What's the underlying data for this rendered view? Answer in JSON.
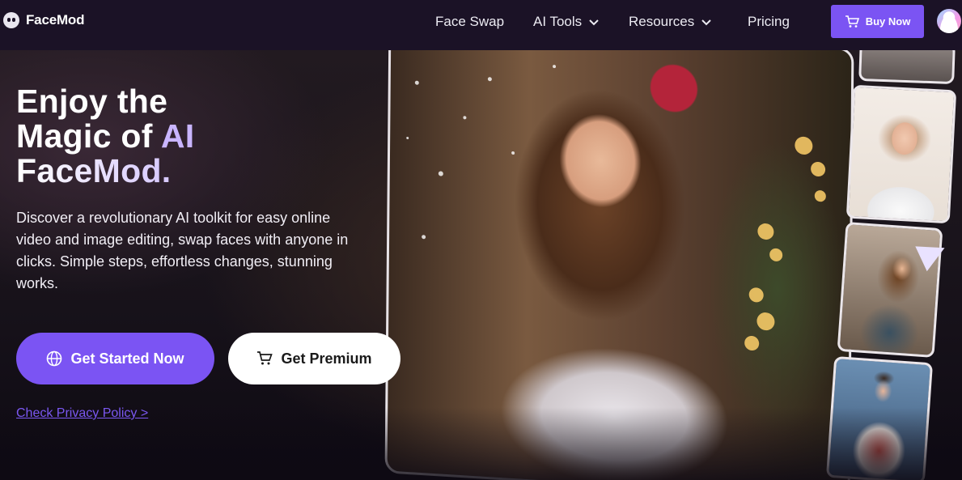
{
  "nav": {
    "brand": "FaceMod",
    "links": [
      {
        "label": "Face Swap"
      },
      {
        "label": "AI Tools"
      },
      {
        "label": "Resources"
      },
      {
        "label": "Pricing"
      }
    ],
    "buy_label": "Buy Now"
  },
  "hero": {
    "title_line1": "Enjoy the",
    "title_line2_prefix": "Magic of ",
    "title_line2_accent": "AI",
    "title_line3": "FaceMod.",
    "description": "Discover a revolutionary AI toolkit for easy online video and image editing, swap faces with anyone in clicks. Simple steps, effortless changes, stunning works.",
    "primary_cta": "Get Started Now",
    "secondary_cta": "Get Premium",
    "privacy_link": "Check Privacy Policy >"
  },
  "colors": {
    "accent": "#7b54f3",
    "accent_text": "#c9b5ff",
    "nav_bg": "#1b1226"
  },
  "icons": {
    "logo": "facemod-logo-icon",
    "cart": "cart-icon",
    "globe": "globe-icon",
    "chevron": "chevron-down-icon",
    "play": "play-icon"
  }
}
